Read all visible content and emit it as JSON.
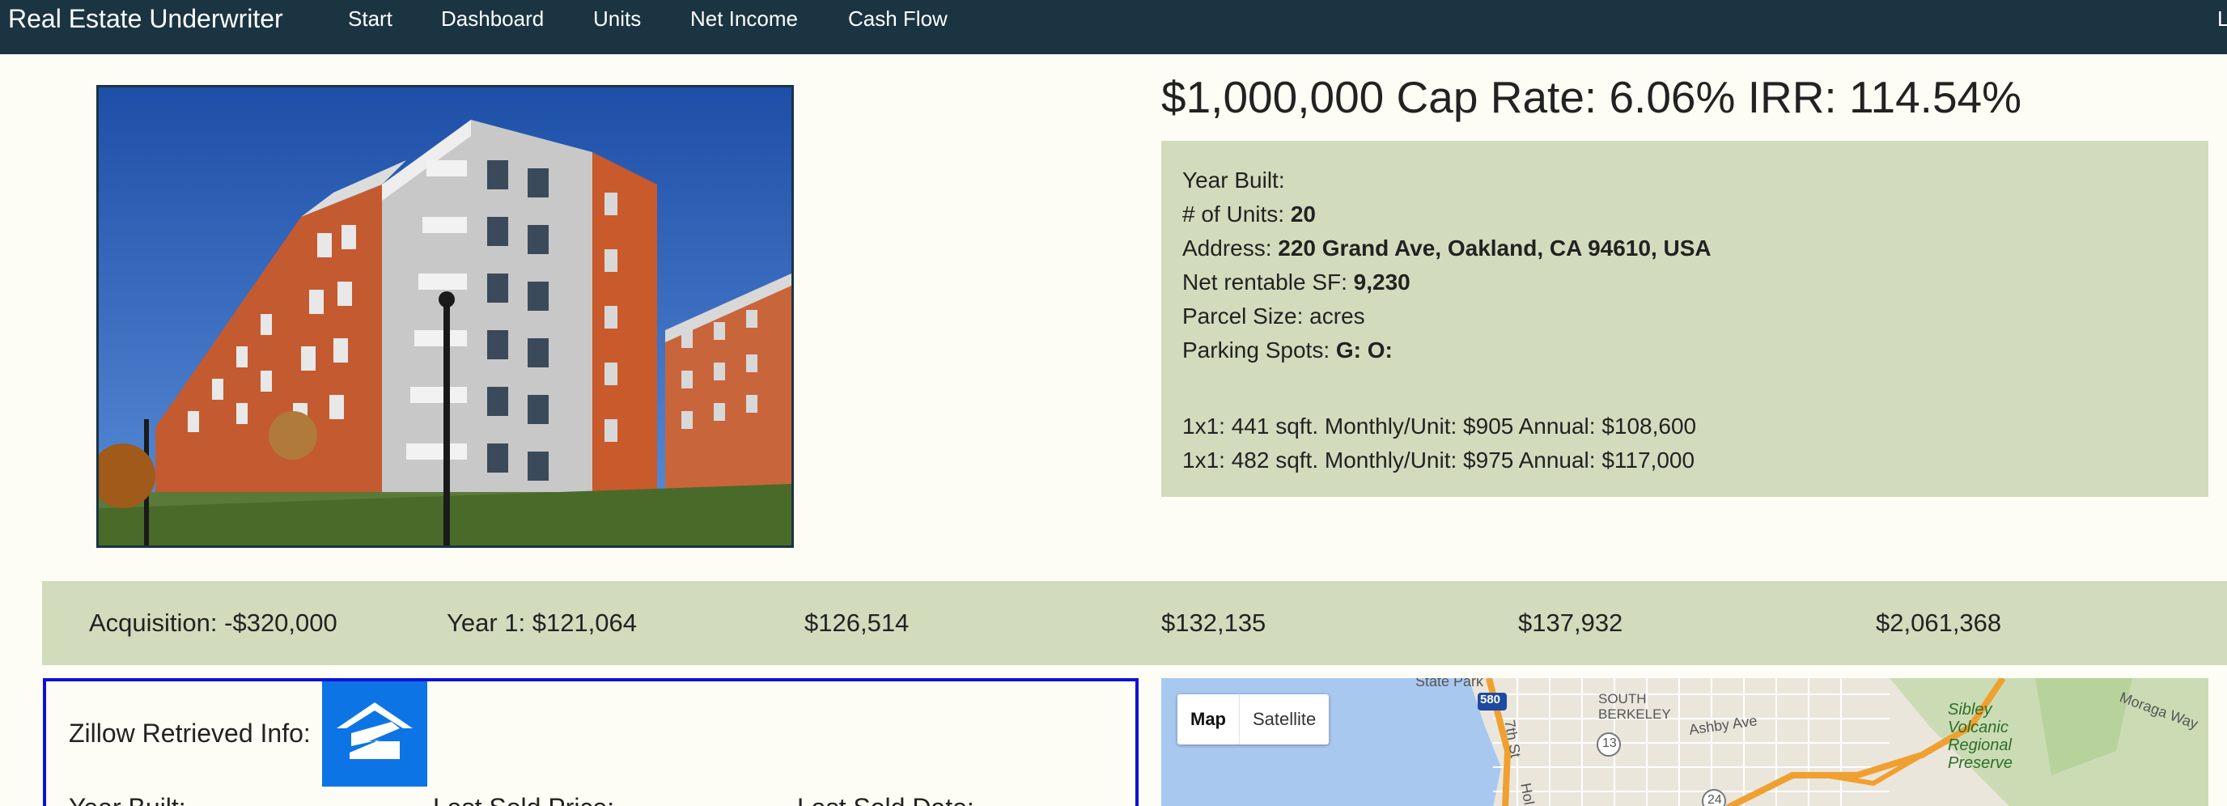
{
  "nav": {
    "brand": "Real Estate Underwriter",
    "links": [
      "Start",
      "Dashboard",
      "Units",
      "Net Income",
      "Cash Flow"
    ],
    "right_partial": "Lo"
  },
  "headline": "$1,000,000 Cap Rate: 6.06% IRR: 114.54%",
  "property": {
    "year_built_label": "Year Built:",
    "units_label": "# of Units:",
    "units_value": "20",
    "address_label": "Address:",
    "address_value": "220 Grand Ave, Oakland, CA 94610, USA",
    "nrsf_label": "Net rentable SF:",
    "nrsf_value": "9,230",
    "parcel_label": "Parcel Size: acres",
    "parking_label": "Parking Spots:",
    "parking_value": "G: O:",
    "unit_mix": [
      "1x1: 441 sqft. Monthly/Unit: $905 Annual: $108,600",
      "1x1: 482 sqft. Monthly/Unit: $975 Annual: $117,000"
    ]
  },
  "cash_flows": [
    "Acquisition: -$320,000",
    "Year 1: $121,064",
    "$126,514",
    "$132,135",
    "$137,932",
    "$2,061,368"
  ],
  "zillow": {
    "title": "Zillow Retrieved Info:",
    "fields": [
      "Year Built:",
      "Last Sold Price:",
      "Last Sold Date:"
    ]
  },
  "map": {
    "type_buttons": [
      "Map",
      "Satellite"
    ],
    "active": "Map",
    "labels": {
      "state_park": "State Park",
      "hwy_580": "580",
      "south_berkeley": "SOUTH\nBERKELEY",
      "ashby": "Ashby Ave",
      "seventh": "7th St",
      "route_13": "13",
      "route_24": "24",
      "sibley": "Sibley\nVolcanic\nRegional\nPreserve",
      "moraga": "Moraga Way",
      "hol": "Hol"
    }
  },
  "colors": {
    "navbar": "#1a3442",
    "panel": "#d2dcbd",
    "page_bg": "#fdfdf5",
    "zillow_border": "#1010d8",
    "zillow_blue": "#0d74e5"
  }
}
